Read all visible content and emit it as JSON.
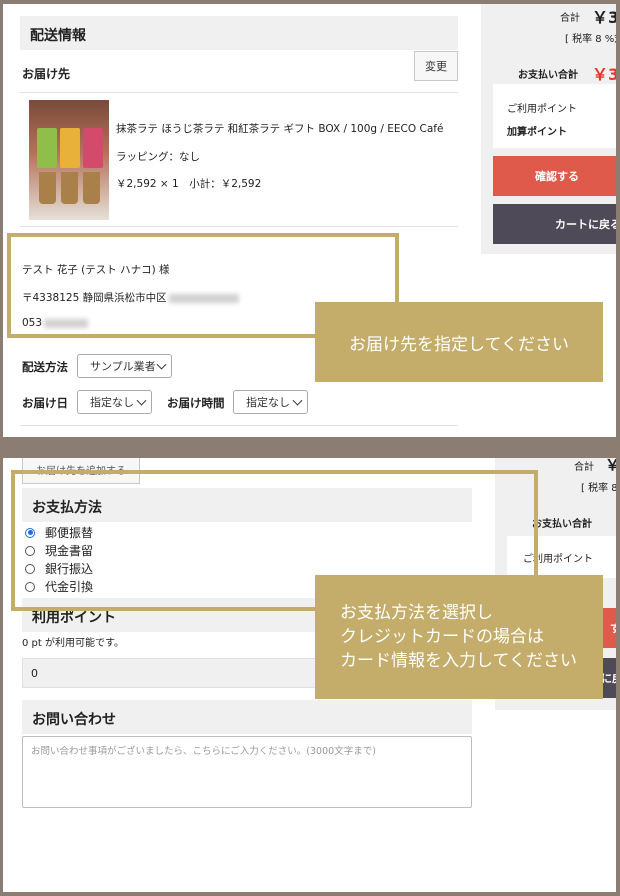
{
  "top": {
    "section_title": "配送情報",
    "delivery_label": "お届け先",
    "change_button": "変更",
    "product": {
      "name": "抹茶ラテ ほうじ茶ラテ 和紅茶ラテ ギフト BOX / 100g / EECO Café",
      "wrapping": "ラッピング：なし",
      "price_line": "￥2,592 × 1　小計：￥2,592"
    },
    "address": {
      "name": "テスト 花子 (テスト ハナコ) 様",
      "postal_city": "〒4338125 静岡県浜松市中区",
      "phone_prefix": "053"
    },
    "shipping_method_label": "配送方法",
    "shipping_method_value": "サンプル業者",
    "delivery_date_label": "お届け日",
    "delivery_date_value": "指定なし",
    "delivery_time_label": "お届け時間",
    "delivery_time_value": "指定なし",
    "sidebar": {
      "total_label": "合計",
      "total_value": "￥3",
      "tax_note": "[ 税率 8 %対",
      "payment_total_label": "お支払い合計",
      "payment_total_value": "￥3",
      "points_used_label": "ご利用ポイント",
      "points_added_label": "加算ポイント",
      "confirm_button": "確認する",
      "back_button": "カートに戻る"
    },
    "callout": "お届け先を指定してください"
  },
  "bottom": {
    "add_address_button": "お届け先を追加する",
    "payment_title": "お支払方法",
    "payment_options": [
      "郵便振替",
      "現金書留",
      "銀行振込",
      "代金引換"
    ],
    "selected_payment_index": 0,
    "points_title": "利用ポイント",
    "points_available": "0 pt が利用可能です。",
    "points_input_value": "0",
    "inquiry_title": "お問い合わせ",
    "inquiry_placeholder": "お問い合わせ事項がございましたら、こちらにご入力ください。(3000文字まで)",
    "sidebar": {
      "total_label": "合計",
      "total_value": "￥",
      "tax_note": "[ 税率 8",
      "payment_total_label": "お支払い合計",
      "points_used_label": "ご利用ポイント",
      "confirm_button_fragment": "す",
      "back_button_fragment": "に戻"
    },
    "callout_lines": [
      "お支払方法を選択し",
      "クレジットカードの場合は",
      "カード情報を入力してください"
    ]
  },
  "colors": {
    "gold": "#c4ad6a",
    "confirm_red": "#e05a4b",
    "back_dark": "#4e4a57",
    "price_red": "#e8362b",
    "frame": "#8b7d72"
  }
}
